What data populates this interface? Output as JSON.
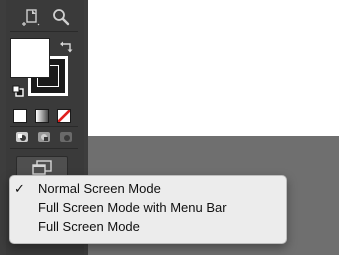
{
  "window": {
    "canvas_color": "#ffffff",
    "pasteboard_color": "#6f6f6f",
    "toolbar_color": "#3d3d3d"
  },
  "toolbar": {
    "tools": [
      {
        "icon": "page-tool-icon"
      },
      {
        "icon": "zoom-tool-icon"
      }
    ],
    "colors": {
      "fill_color": "#ffffff",
      "stroke_color": "#1a1a1a",
      "swap_icon": "swap-fill-stroke-icon",
      "default_icon": "default-fill-stroke-icon"
    },
    "apply_modes": [
      {
        "icon": "apply-color-icon",
        "color": "#ffffff"
      },
      {
        "icon": "apply-gradient-icon",
        "color": "#9a9a9a"
      },
      {
        "icon": "apply-none-icon",
        "color": "#e0201e"
      }
    ],
    "draw_modes": [
      {
        "icon": "draw-normal-icon"
      },
      {
        "icon": "draw-behind-icon"
      },
      {
        "icon": "draw-inside-icon"
      }
    ],
    "screen_mode_icon": "screen-mode-icon"
  },
  "screen_mode_menu": {
    "items": [
      {
        "label": "Normal Screen Mode",
        "checked": true,
        "check_glyph": "✓"
      },
      {
        "label": "Full Screen Mode with Menu Bar",
        "checked": false,
        "check_glyph": ""
      },
      {
        "label": "Full Screen Mode",
        "checked": false,
        "check_glyph": ""
      }
    ]
  }
}
